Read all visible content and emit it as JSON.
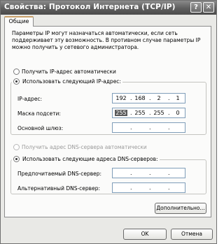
{
  "window": {
    "title": "Свойства: Протокол Интернета (TCP/IP)",
    "help_btn": "?",
    "close_btn": "✕"
  },
  "tabs": [
    {
      "label": "Общие"
    }
  ],
  "intro_text": "Параметры IP могут назначаться автоматически, если сеть поддерживает эту возможность. В противном случае параметры IP можно получить у сетевого администратора.",
  "ip": {
    "auto_label": "Получить IP-адрес автоматически",
    "manual_label": "Использовать следующий IP-адрес:",
    "address_label": "IP-адрес:",
    "address": [
      "192",
      "168",
      "2",
      "1"
    ],
    "mask_label": "Маска подсети:",
    "mask": [
      "255",
      "255",
      "255",
      "0"
    ],
    "gateway_label": "Основной шлюз:",
    "gateway": [
      "",
      "",
      "",
      ""
    ]
  },
  "dns": {
    "auto_label": "Получить адрес DNS-сервера автоматически",
    "manual_label": "Использовать следующие адреса DNS-серверов:",
    "preferred_label": "Предпочитаемый DNS-сервер:",
    "preferred": [
      "",
      "",
      "",
      ""
    ],
    "alternate_label": "Альтернативный DNS-сервер:",
    "alternate": [
      "",
      "",
      "",
      ""
    ]
  },
  "buttons": {
    "advanced": "Дополнительно...",
    "ok": "OK",
    "cancel": "Отмена"
  }
}
